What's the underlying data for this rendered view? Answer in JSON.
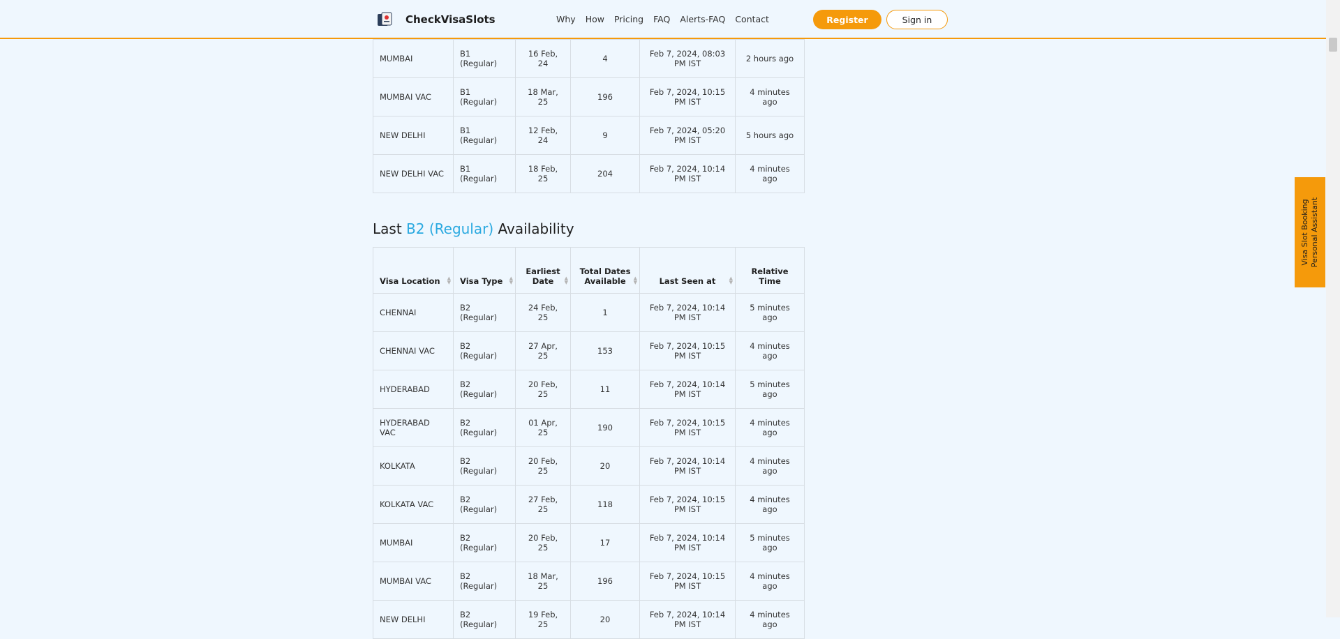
{
  "brand": "CheckVisaSlots",
  "nav": [
    "Why",
    "How",
    "Pricing",
    "FAQ",
    "Alerts-FAQ",
    "Contact"
  ],
  "register": "Register",
  "signin": "Sign in",
  "side_tab": [
    "Visa Slot Booking",
    "Personal Assistant"
  ],
  "top_rows": [
    [
      "MUMBAI",
      "B1 (Regular)",
      "16 Feb, 24",
      "4",
      "Feb 7, 2024, 08:03 PM IST",
      "2 hours ago"
    ],
    [
      "MUMBAI VAC",
      "B1 (Regular)",
      "18 Mar, 25",
      "196",
      "Feb 7, 2024, 10:15 PM IST",
      "4 minutes ago"
    ],
    [
      "NEW DELHI",
      "B1 (Regular)",
      "12 Feb, 24",
      "9",
      "Feb 7, 2024, 05:20 PM IST",
      "5 hours ago"
    ],
    [
      "NEW DELHI VAC",
      "B1 (Regular)",
      "18 Feb, 25",
      "204",
      "Feb 7, 2024, 10:14 PM IST",
      "4 minutes ago"
    ]
  ],
  "section": {
    "prefix": "Last",
    "highlight": "B2 (Regular)",
    "suffix": "Availability"
  },
  "headers": [
    "Visa Location",
    "Visa Type",
    "Earliest Date",
    "Total Dates Available",
    "Last Seen at",
    "Relative Time"
  ],
  "b2_rows": [
    [
      "CHENNAI",
      "B2 (Regular)",
      "24 Feb, 25",
      "1",
      "Feb 7, 2024, 10:14 PM IST",
      "5 minutes ago"
    ],
    [
      "CHENNAI VAC",
      "B2 (Regular)",
      "27 Apr, 25",
      "153",
      "Feb 7, 2024, 10:15 PM IST",
      "4 minutes ago"
    ],
    [
      "HYDERABAD",
      "B2 (Regular)",
      "20 Feb, 25",
      "11",
      "Feb 7, 2024, 10:14 PM IST",
      "5 minutes ago"
    ],
    [
      "HYDERABAD VAC",
      "B2 (Regular)",
      "01 Apr, 25",
      "190",
      "Feb 7, 2024, 10:15 PM IST",
      "4 minutes ago"
    ],
    [
      "KOLKATA",
      "B2 (Regular)",
      "20 Feb, 25",
      "20",
      "Feb 7, 2024, 10:14 PM IST",
      "4 minutes ago"
    ],
    [
      "KOLKATA VAC",
      "B2 (Regular)",
      "27 Feb, 25",
      "118",
      "Feb 7, 2024, 10:15 PM IST",
      "4 minutes ago"
    ],
    [
      "MUMBAI",
      "B2 (Regular)",
      "20 Feb, 25",
      "17",
      "Feb 7, 2024, 10:14 PM IST",
      "5 minutes ago"
    ],
    [
      "MUMBAI VAC",
      "B2 (Regular)",
      "18 Mar, 25",
      "196",
      "Feb 7, 2024, 10:15 PM IST",
      "4 minutes ago"
    ],
    [
      "NEW DELHI",
      "B2 (Regular)",
      "19 Feb, 25",
      "20",
      "Feb 7, 2024, 10:14 PM IST",
      "4 minutes ago"
    ]
  ]
}
